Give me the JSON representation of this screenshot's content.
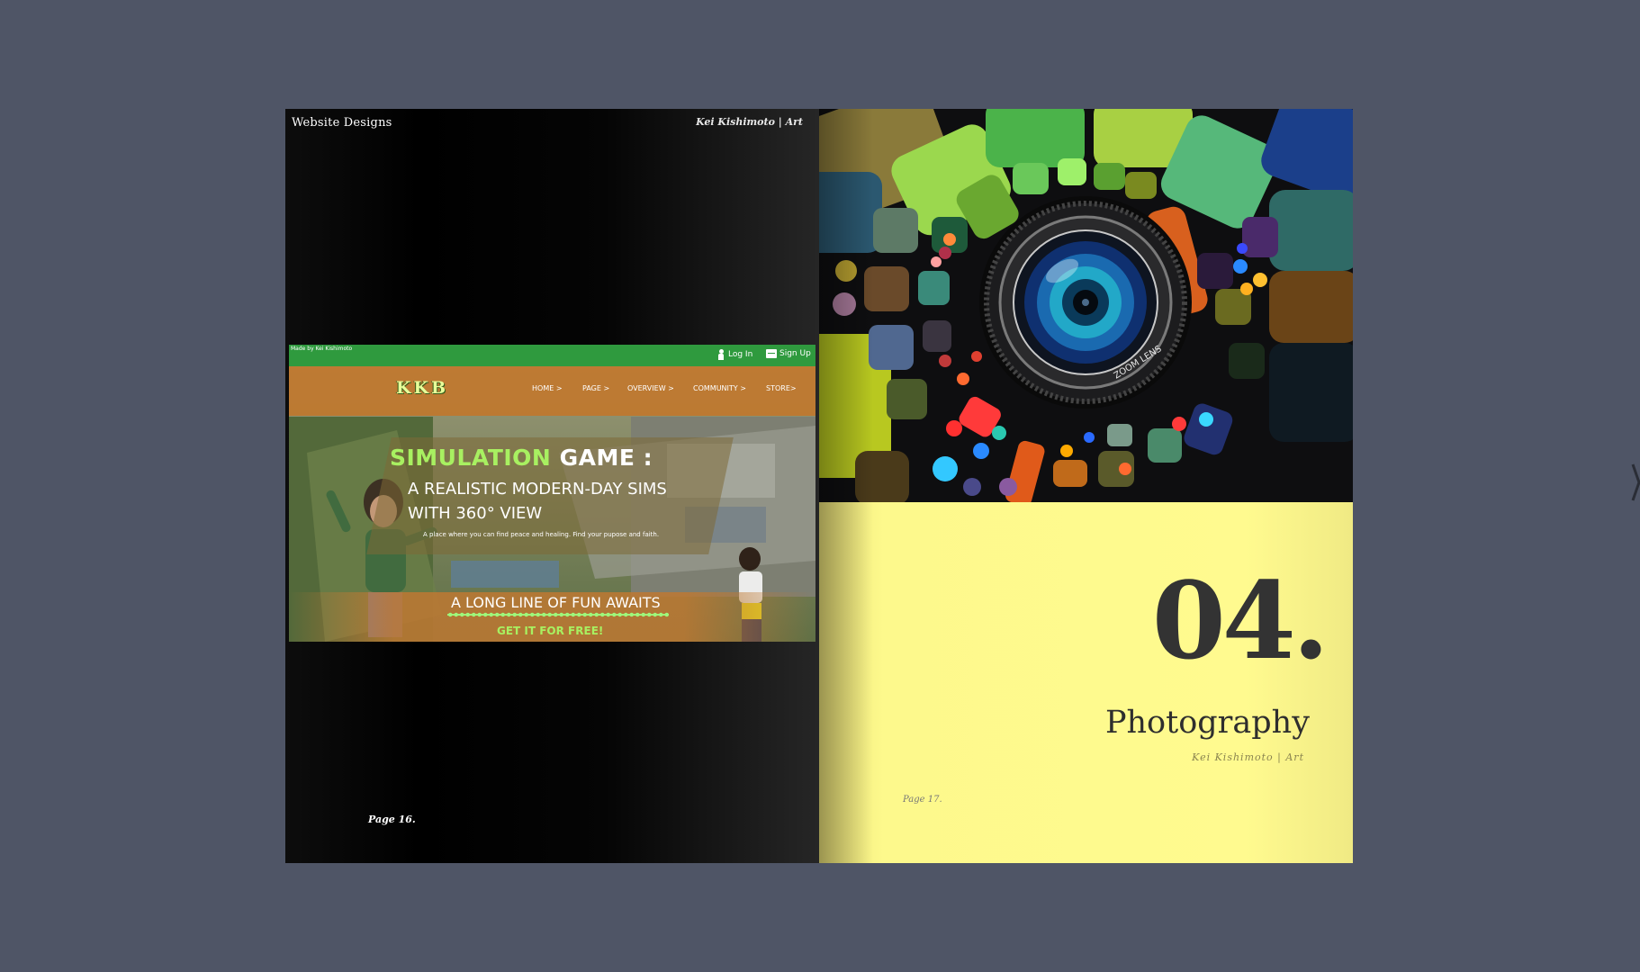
{
  "viewer": {
    "background_color": "#4f5566"
  },
  "left_page": {
    "section_title": "Website Designs",
    "author": "Kei Kishimoto | Art",
    "page_number": "Page 16.",
    "website": {
      "made_by": "Made by Kei Kishimoto",
      "login": "Log In",
      "signup": "Sign Up",
      "logo": "KKB",
      "nav": [
        "HOME >",
        "PAGE >",
        "OVERVIEW >",
        "COMMUNITY >",
        "STORE>"
      ],
      "headline_green": "SIMULATION",
      "headline_white": "GAME :",
      "subhead_line1": "A REALISTIC MODERN-DAY SIMS",
      "subhead_line2": "WITH 360° VIEW",
      "tagline": "A place where you can find peace and healing. Find your pupose and faith.",
      "cta": "A LONG LINE OF FUN AWAITS",
      "cta_button": "GET IT FOR FREE!",
      "colors": {
        "topbar": "#2f9a3e",
        "nav_band": "#c47628",
        "accent_green": "#a8f061"
      }
    }
  },
  "right_page": {
    "lens_label": "ZOOM LENS",
    "chapter_number": "04.",
    "chapter_title": "Photography",
    "author": "Kei Kishimoto | Art",
    "page_number": "Page 17.",
    "background_color": "#fdf98c"
  }
}
